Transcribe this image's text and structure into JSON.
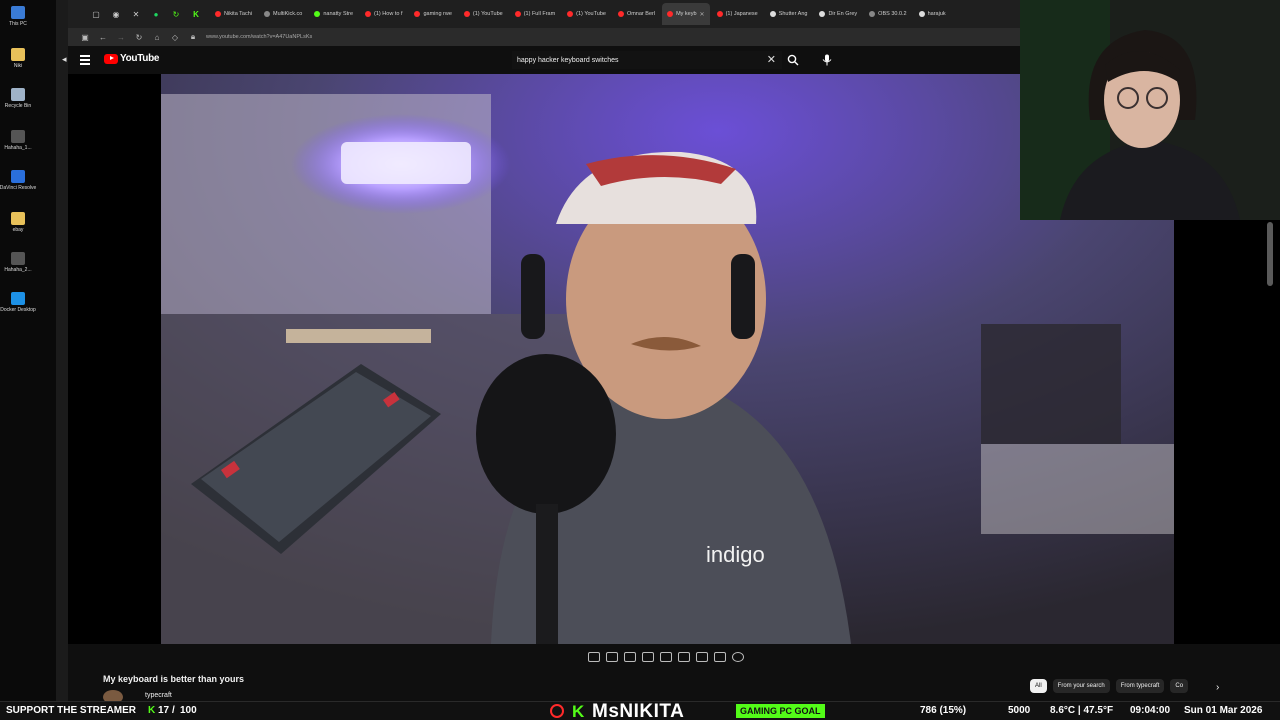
{
  "desktop": {
    "icons": [
      {
        "label": "This PC",
        "color": "#3a7bd5"
      },
      {
        "label": "Niki",
        "color": "#e8c15a"
      },
      {
        "label": "Recycle Bin",
        "color": "#9fb3c8"
      },
      {
        "label": "Hahaha_1...",
        "color": "#555"
      },
      {
        "label": "DaVinci Resolve",
        "color": "#2a6fdb"
      },
      {
        "label": "ebay",
        "color": "#e8c15a"
      },
      {
        "label": "Hahaha_2...",
        "color": "#555"
      },
      {
        "label": "Docker Desktop",
        "color": "#1d91e6"
      }
    ]
  },
  "browser": {
    "tabs": [
      {
        "label": "Nikita Tachi",
        "color": "#ff2a2a"
      },
      {
        "label": "MultiKick.co",
        "color": "#888"
      },
      {
        "label": "nanatty Stre",
        "color": "#53fc18"
      },
      {
        "label": "(1) How to f",
        "color": "#ff2a2a"
      },
      {
        "label": "gaming rwe",
        "color": "#ff2a2a"
      },
      {
        "label": "(1) YouTube",
        "color": "#ff2a2a"
      },
      {
        "label": "(1) Full Fram",
        "color": "#ff2a2a"
      },
      {
        "label": "(1) YouTube",
        "color": "#ff2a2a"
      },
      {
        "label": "Omnar Berl",
        "color": "#ff2a2a"
      },
      {
        "label": "My keyb",
        "color": "#ff2a2a",
        "active": true
      },
      {
        "label": "(1) Japanese",
        "color": "#ff2a2a"
      },
      {
        "label": "Shutter Ang",
        "color": "#ddd"
      },
      {
        "label": "Dir En Grey",
        "color": "#ddd"
      },
      {
        "label": "OBS 30.0.2",
        "color": "#888"
      },
      {
        "label": "harajuk",
        "color": "#ddd"
      }
    ],
    "url": "www.youtube.com/watch?v=A47UaNPLsKs"
  },
  "youtube": {
    "logo_text": "YouTube",
    "search_query": "happy hacker keyboard switches",
    "video_title": "My keyboard is better than yours",
    "channel": "typecraft",
    "shirt_text": "indigo",
    "chips": [
      {
        "label": "All",
        "active": true
      },
      {
        "label": "From your search",
        "active": false
      },
      {
        "label": "From typecraft",
        "active": false
      },
      {
        "label": "Co",
        "active": false
      }
    ]
  },
  "overlay": {
    "support": "SUPPORT THE STREAMER",
    "support_count": "17",
    "support_total": "100",
    "streamer": "MsNIKITA",
    "goal_label": "GAMING PC GOAL",
    "goal_progress": "786 (15%)",
    "goal_target": "5000",
    "weather": "8.6°C | 47.5°F",
    "time": "09:04:00",
    "date": "Sun 01 Mar 2026"
  }
}
